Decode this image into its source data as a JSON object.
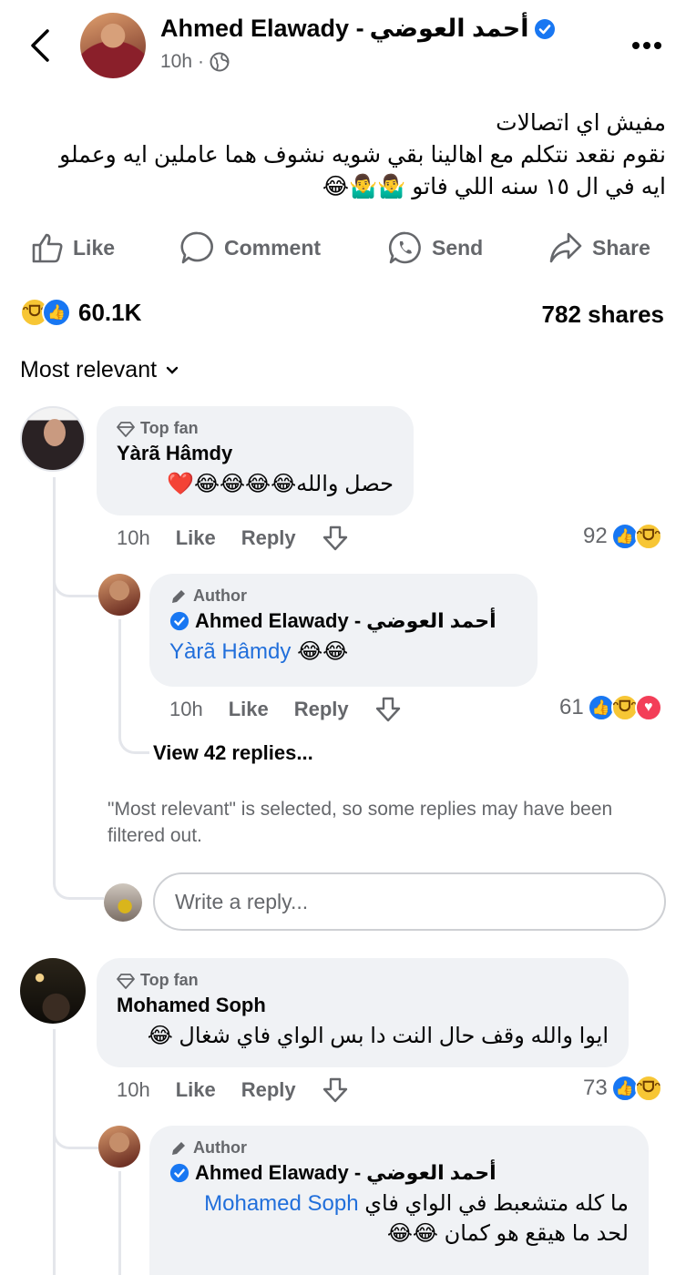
{
  "post": {
    "author_latin": "Ahmed Elawady -",
    "author_arabic": "أحمد العوضي",
    "time": "10h",
    "text_lines": [
      "مفيش اي اتصالات",
      "نقوم نقعد نتكلم  مع اهالينا بقي شويه نشوف هما عاملين ايه وعملو",
      "ايه في ال ١٥ سنه اللي فاتو 🤷‍♂️🤷‍♂️😂"
    ]
  },
  "actions": {
    "like": "Like",
    "comment": "Comment",
    "send": "Send",
    "share": "Share"
  },
  "stats": {
    "reactions": "60.1K",
    "shares": "782 shares"
  },
  "sort": {
    "label": "Most relevant"
  },
  "comments": [
    {
      "badge": "Top fan",
      "name": "Yàrã Hâmdy",
      "text": "حصل والله😂😂😂😂❤️",
      "time": "10h",
      "like": "Like",
      "reply": "Reply",
      "reactions": "92",
      "reply_item": {
        "badge": "Author",
        "name_latin": "Ahmed Elawady -",
        "name_arabic": "أحمد العوضي",
        "mention": "Yàrã Hâmdy",
        "text": "😂😂",
        "time": "10h",
        "like": "Like",
        "reply": "Reply",
        "reactions": "61"
      },
      "view_replies": "View 42 replies...",
      "filter_note": "\"Most relevant\" is selected, so some replies may have been filtered out.",
      "reply_placeholder": "Write a reply..."
    },
    {
      "badge": "Top fan",
      "name": "Mohamed Soph",
      "text": "ايوا والله وقف حال النت دا بس الواي فاي شغال 😂",
      "time": "10h",
      "like": "Like",
      "reply": "Reply",
      "reactions": "73",
      "reply_item": {
        "badge": "Author",
        "name_latin": "Ahmed Elawady -",
        "name_arabic": "أحمد العوضي",
        "mention": "Mohamed Soph",
        "text_line1": "ما كله متشعبط في الواي فاي",
        "text_line2": "لحد ما هيقع هو كمان 😂😂"
      }
    }
  ],
  "colors": {
    "verified": "#1877f2",
    "mention": "#216fdb",
    "bubble": "#f0f2f5",
    "muted": "#65676b"
  }
}
